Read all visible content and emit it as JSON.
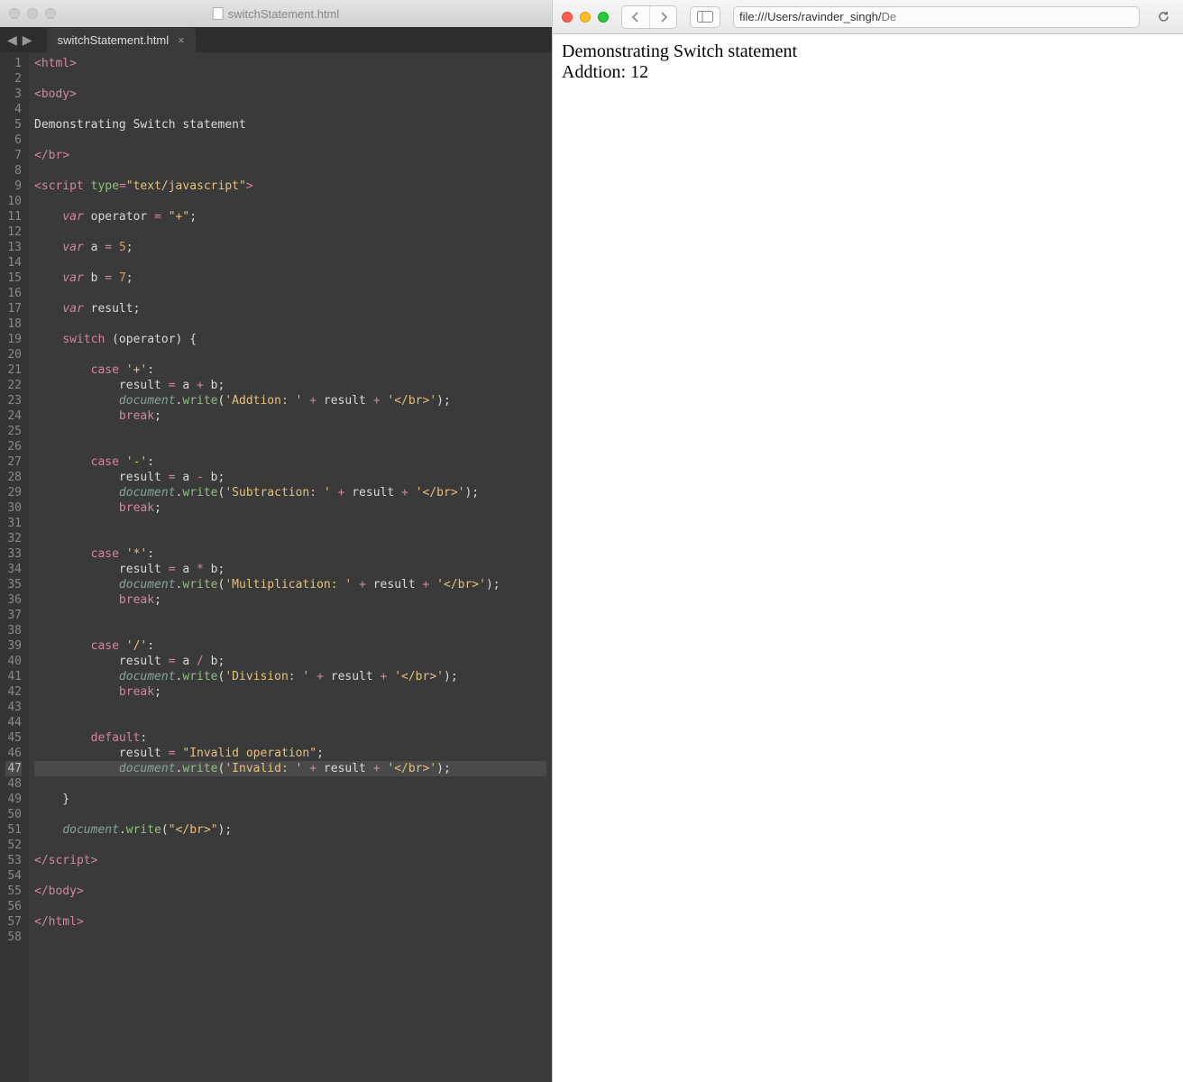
{
  "editor": {
    "title": "switchStatement.html",
    "tab_label": "switchStatement.html",
    "lines_count": 58,
    "highlighted_line": 47,
    "code_tokens": [
      [
        [
          "op",
          "<"
        ],
        [
          "tag",
          "html"
        ],
        [
          "op",
          ">"
        ]
      ],
      [],
      [
        [
          "op",
          "<"
        ],
        [
          "tag",
          "body"
        ],
        [
          "op",
          ">"
        ]
      ],
      [],
      [
        [
          "pl",
          "Demonstrating Switch statement"
        ]
      ],
      [],
      [
        [
          "op",
          "</"
        ],
        [
          "tag",
          "br"
        ],
        [
          "op",
          ">"
        ]
      ],
      [],
      [
        [
          "op",
          "<"
        ],
        [
          "tag",
          "script"
        ],
        [
          "pl",
          " "
        ],
        [
          "attr",
          "type"
        ],
        [
          "op",
          "="
        ],
        [
          "str",
          "\"text/javascript\""
        ],
        [
          "op",
          ">"
        ]
      ],
      [],
      [
        [
          "pl",
          "    "
        ],
        [
          "sto",
          "var"
        ],
        [
          "pl",
          " operator "
        ],
        [
          "op",
          "="
        ],
        [
          "pl",
          " "
        ],
        [
          "str",
          "\"+\""
        ],
        [
          "pl",
          ";"
        ]
      ],
      [],
      [
        [
          "pl",
          "    "
        ],
        [
          "sto",
          "var"
        ],
        [
          "pl",
          " a "
        ],
        [
          "op",
          "="
        ],
        [
          "pl",
          " "
        ],
        [
          "num",
          "5"
        ],
        [
          "pl",
          ";"
        ]
      ],
      [],
      [
        [
          "pl",
          "    "
        ],
        [
          "sto",
          "var"
        ],
        [
          "pl",
          " b "
        ],
        [
          "op",
          "="
        ],
        [
          "pl",
          " "
        ],
        [
          "num",
          "7"
        ],
        [
          "pl",
          ";"
        ]
      ],
      [],
      [
        [
          "pl",
          "    "
        ],
        [
          "sto",
          "var"
        ],
        [
          "pl",
          " result;"
        ]
      ],
      [],
      [
        [
          "pl",
          "    "
        ],
        [
          "kw",
          "switch"
        ],
        [
          "pl",
          " (operator) {"
        ]
      ],
      [],
      [
        [
          "pl",
          "        "
        ],
        [
          "kw",
          "case"
        ],
        [
          "pl",
          " "
        ],
        [
          "str",
          "'+'"
        ],
        [
          "pl",
          ":"
        ]
      ],
      [
        [
          "pl",
          "            result "
        ],
        [
          "op",
          "="
        ],
        [
          "pl",
          " a "
        ],
        [
          "op",
          "+"
        ],
        [
          "pl",
          " b;"
        ]
      ],
      [
        [
          "pl",
          "            "
        ],
        [
          "doc",
          "document"
        ],
        [
          "pl",
          "."
        ],
        [
          "fn",
          "write"
        ],
        [
          "pl",
          "("
        ],
        [
          "str",
          "'Addtion: '"
        ],
        [
          "pl",
          " "
        ],
        [
          "op",
          "+"
        ],
        [
          "pl",
          " result "
        ],
        [
          "op",
          "+"
        ],
        [
          "pl",
          " "
        ],
        [
          "str",
          "'</br>'"
        ],
        [
          "pl",
          ");"
        ]
      ],
      [
        [
          "pl",
          "            "
        ],
        [
          "kw",
          "break"
        ],
        [
          "pl",
          ";"
        ]
      ],
      [],
      [],
      [
        [
          "pl",
          "        "
        ],
        [
          "kw",
          "case"
        ],
        [
          "pl",
          " "
        ],
        [
          "str",
          "'-'"
        ],
        [
          "pl",
          ":"
        ]
      ],
      [
        [
          "pl",
          "            result "
        ],
        [
          "op",
          "="
        ],
        [
          "pl",
          " a "
        ],
        [
          "op",
          "-"
        ],
        [
          "pl",
          " b;"
        ]
      ],
      [
        [
          "pl",
          "            "
        ],
        [
          "doc",
          "document"
        ],
        [
          "pl",
          "."
        ],
        [
          "fn",
          "write"
        ],
        [
          "pl",
          "("
        ],
        [
          "str",
          "'Subtraction: '"
        ],
        [
          "pl",
          " "
        ],
        [
          "op",
          "+"
        ],
        [
          "pl",
          " result "
        ],
        [
          "op",
          "+"
        ],
        [
          "pl",
          " "
        ],
        [
          "str",
          "'</br>'"
        ],
        [
          "pl",
          ");"
        ]
      ],
      [
        [
          "pl",
          "            "
        ],
        [
          "kw",
          "break"
        ],
        [
          "pl",
          ";"
        ]
      ],
      [],
      [],
      [
        [
          "pl",
          "        "
        ],
        [
          "kw",
          "case"
        ],
        [
          "pl",
          " "
        ],
        [
          "str",
          "'*'"
        ],
        [
          "pl",
          ":"
        ]
      ],
      [
        [
          "pl",
          "            result "
        ],
        [
          "op",
          "="
        ],
        [
          "pl",
          " a "
        ],
        [
          "op",
          "*"
        ],
        [
          "pl",
          " b;"
        ]
      ],
      [
        [
          "pl",
          "            "
        ],
        [
          "doc",
          "document"
        ],
        [
          "pl",
          "."
        ],
        [
          "fn",
          "write"
        ],
        [
          "pl",
          "("
        ],
        [
          "str",
          "'Multiplication: '"
        ],
        [
          "pl",
          " "
        ],
        [
          "op",
          "+"
        ],
        [
          "pl",
          " result "
        ],
        [
          "op",
          "+"
        ],
        [
          "pl",
          " "
        ],
        [
          "str",
          "'</br>'"
        ],
        [
          "pl",
          ");"
        ]
      ],
      [
        [
          "pl",
          "            "
        ],
        [
          "kw",
          "break"
        ],
        [
          "pl",
          ";"
        ]
      ],
      [],
      [],
      [
        [
          "pl",
          "        "
        ],
        [
          "kw",
          "case"
        ],
        [
          "pl",
          " "
        ],
        [
          "str",
          "'/'"
        ],
        [
          "pl",
          ":"
        ]
      ],
      [
        [
          "pl",
          "            result "
        ],
        [
          "op",
          "="
        ],
        [
          "pl",
          " a "
        ],
        [
          "op",
          "/"
        ],
        [
          "pl",
          " b;"
        ]
      ],
      [
        [
          "pl",
          "            "
        ],
        [
          "doc",
          "document"
        ],
        [
          "pl",
          "."
        ],
        [
          "fn",
          "write"
        ],
        [
          "pl",
          "("
        ],
        [
          "str",
          "'Division: '"
        ],
        [
          "pl",
          " "
        ],
        [
          "op",
          "+"
        ],
        [
          "pl",
          " result "
        ],
        [
          "op",
          "+"
        ],
        [
          "pl",
          " "
        ],
        [
          "str",
          "'</br>'"
        ],
        [
          "pl",
          ");"
        ]
      ],
      [
        [
          "pl",
          "            "
        ],
        [
          "kw",
          "break"
        ],
        [
          "pl",
          ";"
        ]
      ],
      [],
      [],
      [
        [
          "pl",
          "        "
        ],
        [
          "kw",
          "default"
        ],
        [
          "pl",
          ":"
        ]
      ],
      [
        [
          "pl",
          "            result "
        ],
        [
          "op",
          "="
        ],
        [
          "pl",
          " "
        ],
        [
          "str",
          "\"Invalid operation\""
        ],
        [
          "pl",
          ";"
        ]
      ],
      [
        [
          "pl",
          "            "
        ],
        [
          "doc",
          "document"
        ],
        [
          "pl",
          "."
        ],
        [
          "fn",
          "write"
        ],
        [
          "pl",
          "("
        ],
        [
          "str",
          "'Invalid: '"
        ],
        [
          "pl",
          " "
        ],
        [
          "op",
          "+"
        ],
        [
          "pl",
          " result "
        ],
        [
          "op",
          "+"
        ],
        [
          "pl",
          " "
        ],
        [
          "str",
          "'</br>'"
        ],
        [
          "pl",
          ");"
        ]
      ],
      [],
      [
        [
          "pl",
          "    }"
        ]
      ],
      [],
      [
        [
          "pl",
          "    "
        ],
        [
          "doc",
          "document"
        ],
        [
          "pl",
          "."
        ],
        [
          "fn",
          "write"
        ],
        [
          "pl",
          "("
        ],
        [
          "str",
          "\"</br>\""
        ],
        [
          "pl",
          ");"
        ]
      ],
      [],
      [
        [
          "op",
          "</"
        ],
        [
          "tag",
          "script"
        ],
        [
          "op",
          ">"
        ]
      ],
      [],
      [
        [
          "op",
          "</"
        ],
        [
          "tag",
          "body"
        ],
        [
          "op",
          ">"
        ]
      ],
      [],
      [
        [
          "op",
          "</"
        ],
        [
          "tag",
          "html"
        ],
        [
          "op",
          ">"
        ]
      ],
      []
    ]
  },
  "browser": {
    "address_prefix": "file:///Users/ravinder_singh/",
    "address_dim": "De",
    "content_line1": "Demonstrating Switch statement",
    "content_line2": "Addtion: 12"
  }
}
